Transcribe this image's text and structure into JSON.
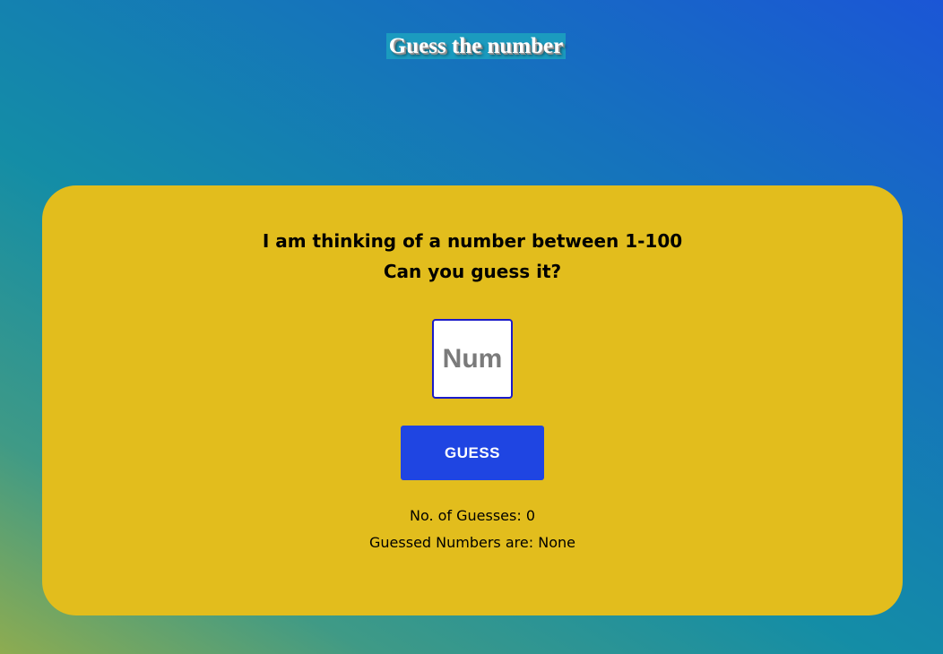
{
  "header": {
    "title": "Guess the number"
  },
  "game": {
    "prompt_line_1": "I am thinking of a number between 1-100",
    "prompt_line_2": "Can you guess it?",
    "input_placeholder": "Num",
    "input_value": "",
    "guess_button_label": "GUESS",
    "guess_count_label": "No. of Guesses:",
    "guess_count": "0",
    "guessed_numbers_label": "Guessed Numbers are:",
    "guessed_numbers": "None"
  },
  "colors": {
    "card_background": "#e2bd1d",
    "button_background": "#1f45e2",
    "input_border": "#1b1bc9",
    "title_background": "#1b9bbf"
  }
}
